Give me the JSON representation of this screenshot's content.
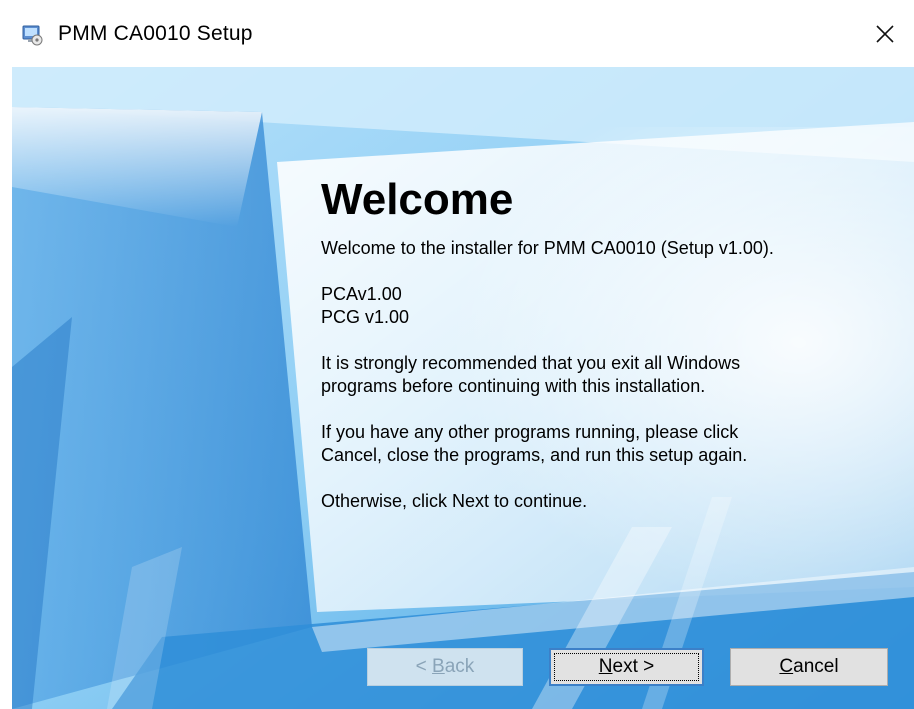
{
  "window": {
    "title": "PMM CA0010 Setup",
    "icons": {
      "app": "installer-app-icon",
      "close": "close-icon"
    }
  },
  "welcome": {
    "heading": "Welcome",
    "intro": "Welcome to the installer for PMM CA0010 (Setup v1.00).",
    "versions": [
      "PCAv1.00",
      "PCG v1.00"
    ],
    "recommend_line1": "It is strongly recommended that you exit all Windows",
    "recommend_line2": "programs before continuing with this installation.",
    "running_line1": "If you have any other programs running, please click",
    "running_line2": "Cancel, close the programs, and run this setup again.",
    "continue_text": "Otherwise, click Next to continue."
  },
  "buttons": {
    "back": {
      "hotkey": "B",
      "label": "< Back",
      "prefix": "< ",
      "underlined": "B",
      "rest": "ack",
      "enabled": false
    },
    "next": {
      "hotkey": "N",
      "label": "Next >",
      "underlined": "N",
      "rest": "ext >",
      "focused": true
    },
    "cancel": {
      "hotkey": "C",
      "label": "Cancel",
      "underlined": "C",
      "rest": "ancel"
    }
  },
  "colors": {
    "accent_border": "#3c80c8",
    "background_blue": "#7cc3ee",
    "text": "#000000",
    "disabled_text": "#8aa4b8"
  }
}
